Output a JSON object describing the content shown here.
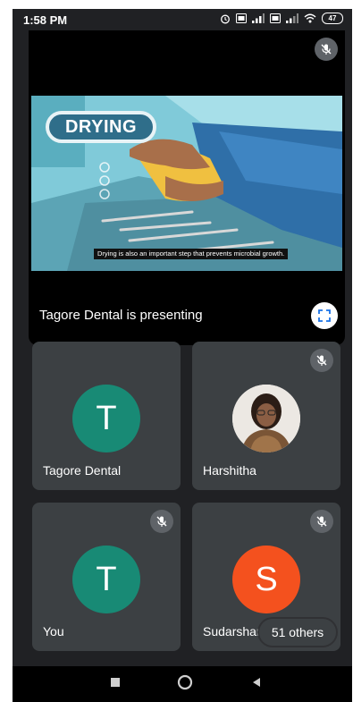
{
  "status_bar": {
    "time": "1:58 PM",
    "battery": "47",
    "icons": [
      "alarm-icon",
      "volte-icon",
      "signal-icon",
      "volte-icon",
      "signal-icon",
      "wifi-icon",
      "battery-icon"
    ]
  },
  "presentation": {
    "slide_title": "DRYING",
    "caption": "Drying is also an important step that prevents microbial growth.",
    "presenter_label": "Tagore Dental  is presenting"
  },
  "participants": [
    {
      "name": "Tagore Dental",
      "initial": "T",
      "color": "#188a75",
      "muted": false
    },
    {
      "name": "Harshitha",
      "initial": "",
      "color": "#6b4b3a",
      "muted": true
    },
    {
      "name": "You",
      "initial": "T",
      "color": "#188a75",
      "muted": true
    },
    {
      "name": "Sudarshan",
      "initial": "S",
      "color": "#f4511e",
      "muted": true
    }
  ],
  "others": {
    "label": "51 others"
  },
  "colors": {
    "background": "#202124",
    "tile": "#3c4043",
    "mute_badge": "#5f6368"
  }
}
